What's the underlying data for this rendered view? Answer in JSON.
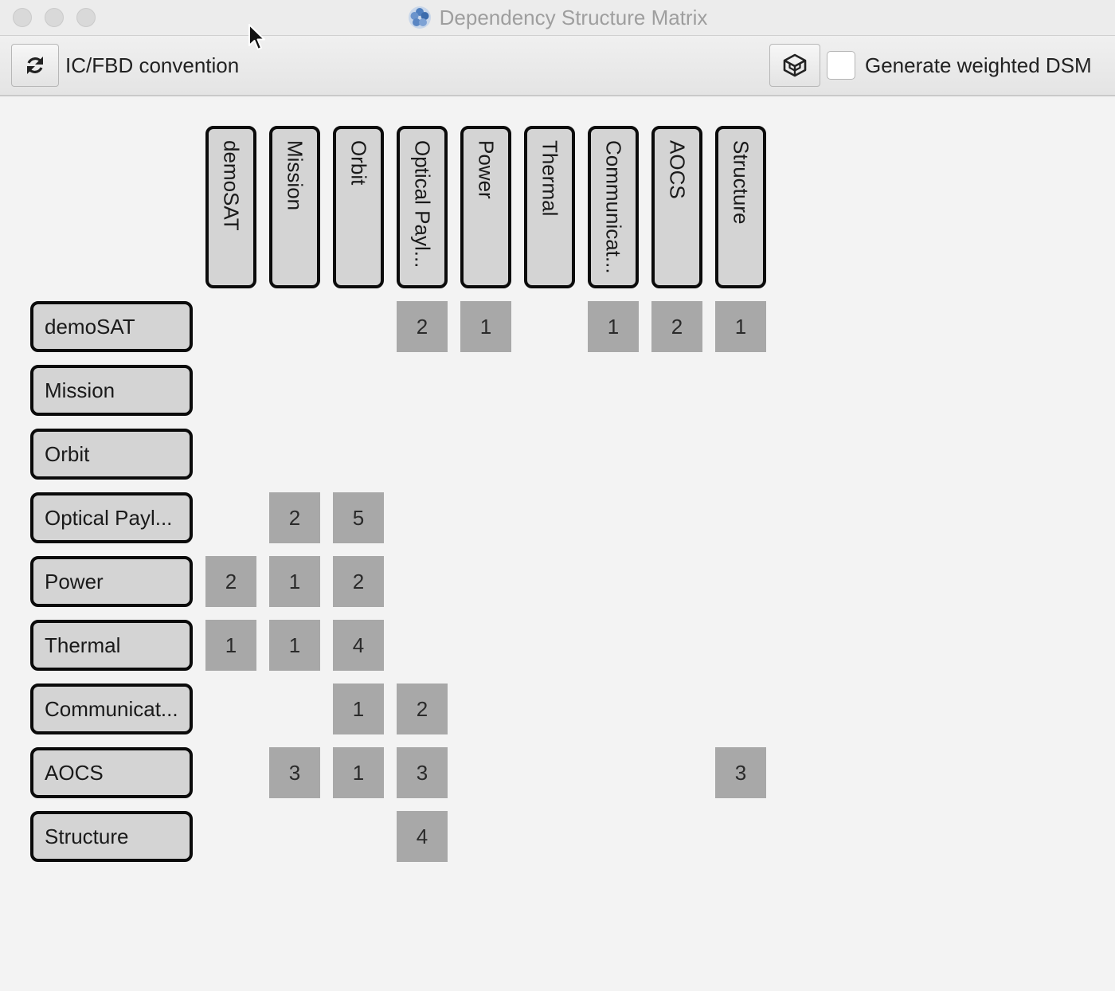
{
  "window": {
    "title": "Dependency Structure Matrix",
    "app_icon": "blue-cells-icon"
  },
  "toolbar": {
    "refresh_icon": "refresh-icon",
    "convention_label": "IC/FBD convention",
    "export_icon": "cube-icon",
    "weighted_label": "Generate weighted DSM",
    "weighted_checked": false
  },
  "matrix": {
    "columns": [
      "demoSAT",
      "Mission",
      "Orbit",
      "Optical Payl...",
      "Power",
      "Thermal",
      "Communicat...",
      "AOCS",
      "Structure"
    ],
    "rows": [
      "demoSAT",
      "Mission",
      "Orbit",
      "Optical Payl...",
      "Power",
      "Thermal",
      "Communicat...",
      "AOCS",
      "Structure"
    ],
    "cells": [
      {
        "row": 0,
        "col": 3,
        "value": "2"
      },
      {
        "row": 0,
        "col": 4,
        "value": "1"
      },
      {
        "row": 0,
        "col": 6,
        "value": "1"
      },
      {
        "row": 0,
        "col": 7,
        "value": "2"
      },
      {
        "row": 0,
        "col": 8,
        "value": "1"
      },
      {
        "row": 3,
        "col": 1,
        "value": "2"
      },
      {
        "row": 3,
        "col": 2,
        "value": "5"
      },
      {
        "row": 4,
        "col": 0,
        "value": "2"
      },
      {
        "row": 4,
        "col": 1,
        "value": "1"
      },
      {
        "row": 4,
        "col": 2,
        "value": "2"
      },
      {
        "row": 5,
        "col": 0,
        "value": "1"
      },
      {
        "row": 5,
        "col": 1,
        "value": "1"
      },
      {
        "row": 5,
        "col": 2,
        "value": "4"
      },
      {
        "row": 6,
        "col": 2,
        "value": "1"
      },
      {
        "row": 6,
        "col": 3,
        "value": "2"
      },
      {
        "row": 7,
        "col": 1,
        "value": "3"
      },
      {
        "row": 7,
        "col": 2,
        "value": "1"
      },
      {
        "row": 7,
        "col": 3,
        "value": "3"
      },
      {
        "row": 7,
        "col": 8,
        "value": "3"
      },
      {
        "row": 8,
        "col": 3,
        "value": "4"
      }
    ],
    "colors": {
      "header_bg": "#d4d4d4",
      "header_border": "#0b0b0b",
      "cell_bg": "#a8a8a8"
    }
  }
}
